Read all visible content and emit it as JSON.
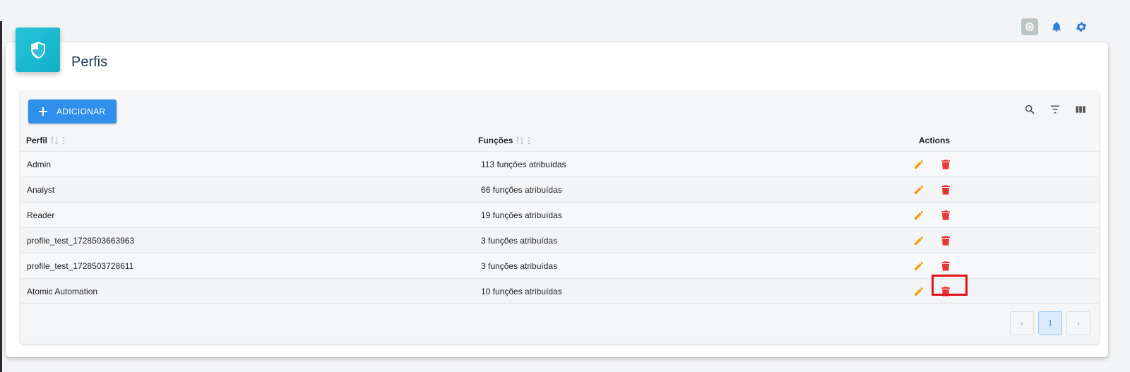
{
  "header": {
    "title": "Perfis"
  },
  "topbar": {
    "icons": [
      "ai-assistant-icon",
      "bell-icon",
      "gear-icon"
    ]
  },
  "toolbar": {
    "add_label": "ADICIONAR",
    "icons": [
      "search-icon",
      "filter-icon",
      "columns-icon"
    ]
  },
  "table": {
    "columns": [
      "Perfil",
      "Funções",
      "Actions"
    ],
    "rows": [
      {
        "perfil": "Admin",
        "funcoes": "113 funções atribuídas"
      },
      {
        "perfil": "Analyst",
        "funcoes": "66 funções atribuídas"
      },
      {
        "perfil": "Reader",
        "funcoes": "19 funções atribuídas"
      },
      {
        "perfil": "profile_test_1728503663963",
        "funcoes": "3 funções atribuídas"
      },
      {
        "perfil": "profile_test_1728503728611",
        "funcoes": "3 funções atribuídas"
      },
      {
        "perfil": "Atomic Automation",
        "funcoes": "10 funções atribuídas"
      }
    ]
  },
  "pagination": {
    "prev": "‹",
    "current": "1",
    "next": "›"
  },
  "colors": {
    "accent": "#2f8fea",
    "badge": "#1cb8d0",
    "edit": "#f39c12",
    "delete": "#e53935",
    "highlight": "#e0121b"
  }
}
